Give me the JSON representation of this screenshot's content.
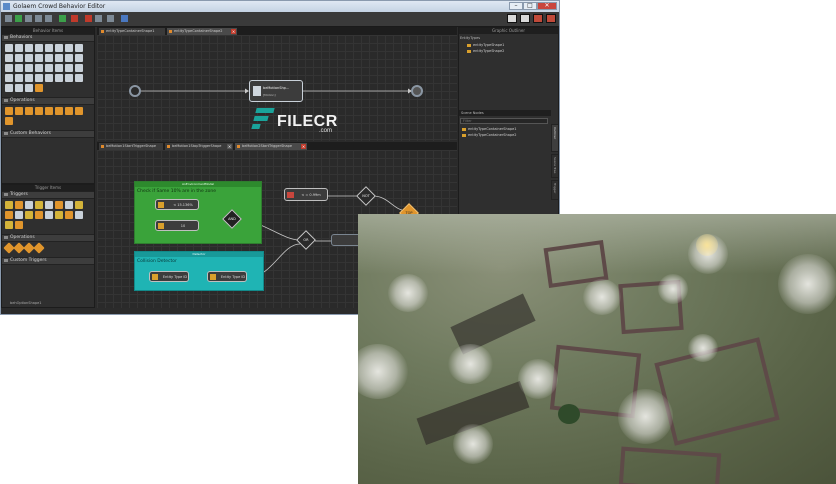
{
  "window": {
    "title": "Golaem Crowd Behavior Editor",
    "min": "–",
    "max": "□",
    "close": "✕"
  },
  "left_panel": {
    "behaviors_header": "Behavior Items",
    "sections": [
      "Behaviors",
      "Operations",
      "Custom Behaviors"
    ],
    "trigger_header": "Trigger Items",
    "trigger_sections": [
      "Triggers",
      "Operations",
      "Custom Triggers"
    ],
    "footer": "behOptionShape1"
  },
  "main_tabs": [
    {
      "label": "entityTypeContainerShape1",
      "active": false
    },
    {
      "label": "entityTypeContainerShape2",
      "active": true
    }
  ],
  "behavior_graph": {
    "node_label": "beMotionShp...",
    "node_sub": "[Motion]"
  },
  "trigger_tabs": [
    {
      "label": "beMotion1StartTriggerShape",
      "active": false
    },
    {
      "label": "beMotion1StopTriggerShape",
      "active": false
    },
    {
      "label": "beMotion2StartTriggerShape",
      "active": true
    }
  ],
  "trigger_graph": {
    "green_box": {
      "header": "AnEnvironmentModel",
      "title": "Check if Same 10% are in the zone",
      "item1": "< 15.136%",
      "item2": "10"
    },
    "cyan_box": {
      "header": "Detector",
      "title": "Collision Detector",
      "item1": "Entity Type ID",
      "item2": "Entity Type ID"
    },
    "op_and": "AND",
    "op_or": "OR",
    "op_not": "NOT",
    "op_top": "TOP",
    "dist_node": "< = 0.99m"
  },
  "right_panel": {
    "header": "Graphic Outliner",
    "entity_types_label": "EntityTypes",
    "entity_types": [
      "entityTypeShape1",
      "entityTypeShape2"
    ],
    "scene_nodes_label": "Scene Nodes",
    "filter_placeholder": "Filter",
    "scene_nodes": [
      "entityTypeContainerShape1",
      "entityTypeContainerShape2"
    ],
    "side_tabs": [
      "Outliner",
      "Scene Tree",
      "Trigger"
    ]
  },
  "watermark": {
    "text": "FILECR",
    "sub": ".com"
  }
}
